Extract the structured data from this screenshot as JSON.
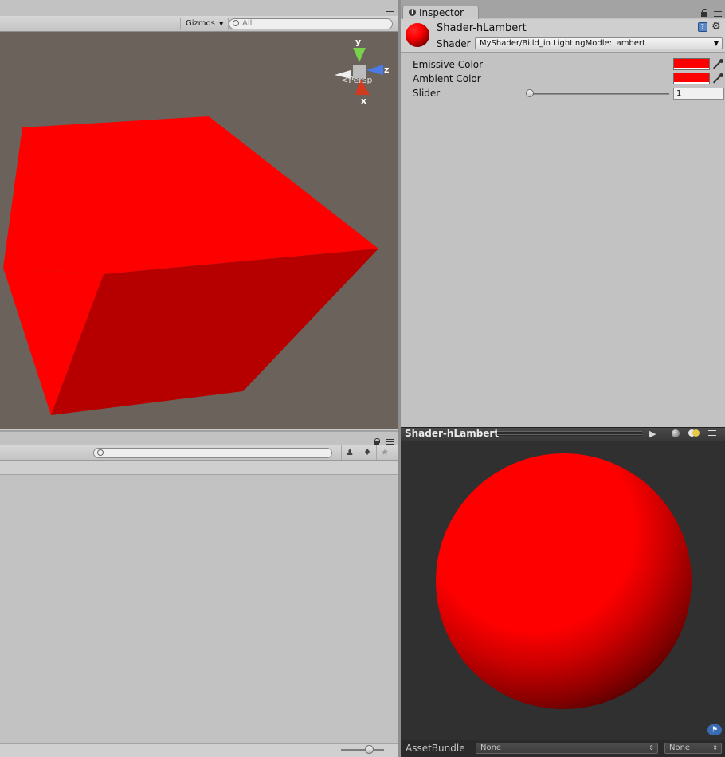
{
  "scene": {
    "gizmos_label": "Gizmos",
    "search_placeholder": "All",
    "axis_labels": {
      "y": "y",
      "z": "z",
      "x": "x"
    },
    "projection_label": "Persp",
    "cube_color": "#ff0000",
    "background_color": "#6a625b"
  },
  "inspector": {
    "tab_label": "Inspector",
    "material_name": "Shader-hLambert",
    "shader_label": "Shader",
    "shader_value": "MyShader/Biild_in LightingModle:Lambert",
    "properties": [
      {
        "label": "Emissive Color",
        "color": "#ff0000"
      },
      {
        "label": "Ambient Color",
        "color": "#ff0000"
      },
      {
        "label": "Slider",
        "value": "1",
        "slider_fraction": 0.0
      }
    ],
    "icons": [
      "info-icon",
      "help-icon",
      "gear-icon",
      "lock-icon",
      "menu-icon",
      "eyedropper-icon"
    ]
  },
  "preview": {
    "title": "Shader-hLambert",
    "assetbundle_label": "AssetBundle",
    "bundle_name": "None",
    "bundle_variant": "None",
    "sphere_color": "#ff0000"
  },
  "project": {
    "toolbar_icons": [
      "filter-by-type-icon",
      "filter-by-label-icon",
      "favorite-star-icon"
    ],
    "zoom_fraction": 0.65
  }
}
